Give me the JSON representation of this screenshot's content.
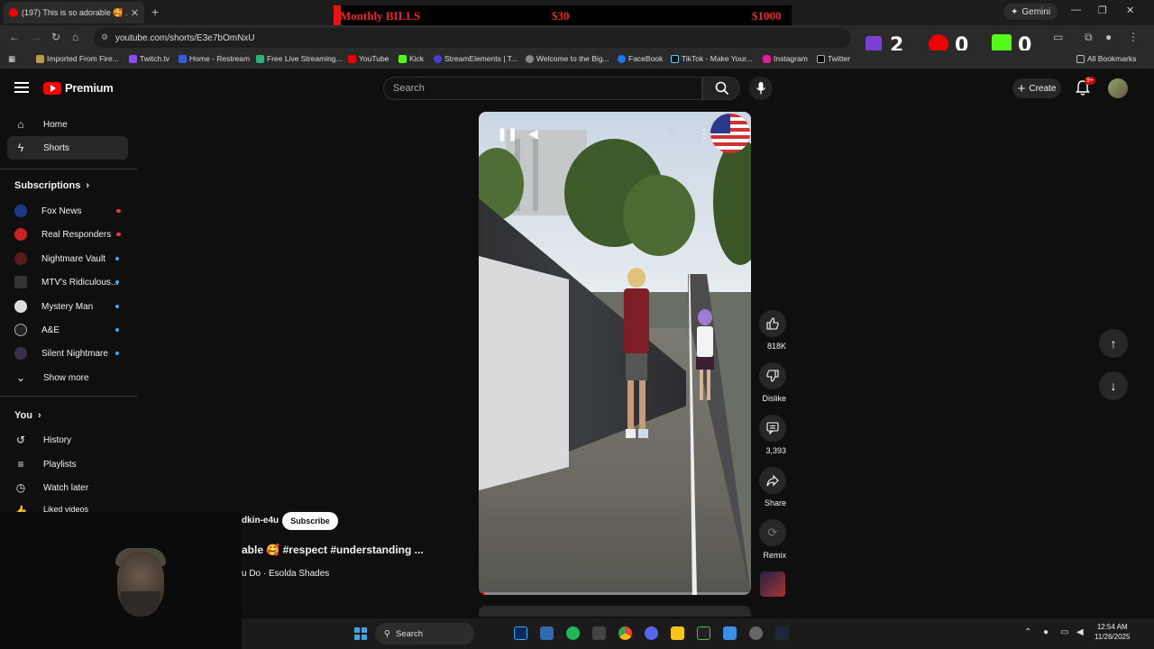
{
  "browser": {
    "tab_title": "(197) This is so adorable 🥰 ...",
    "url": "youtube.com/shorts/E3e7bOmNxU",
    "gemini_label": "Gemini",
    "bookmarks": [
      "Imported From Fire...",
      "Twitch.tv",
      "Home - Restream",
      "Free Live Streaming...",
      "YouTube",
      "Kick",
      "StreamElements | T...",
      "Welcome to the Big...",
      "FaceBook",
      "TikTok - Make Your...",
      "Instagram",
      "Twitter"
    ],
    "all_bookmarks_label": "All Bookmarks"
  },
  "overlay_bills": {
    "title": "Monthly BILLS",
    "value1": "$30",
    "value2": "$1000"
  },
  "stream_counters": {
    "twitch": "2",
    "youtube": "0",
    "kick": "0"
  },
  "yt": {
    "logo_text": "Premium",
    "search_placeholder": "Search",
    "create_label": "Create",
    "notif_badge": "9+"
  },
  "sidebar": {
    "primary": [
      {
        "label": "Home"
      },
      {
        "label": "Shorts"
      }
    ],
    "subscriptions_header": "Subscriptions",
    "subscriptions": [
      {
        "label": "Fox News"
      },
      {
        "label": "Real Responders"
      },
      {
        "label": "Nightmare Vault"
      },
      {
        "label": "MTV's Ridiculous..."
      },
      {
        "label": "Mystery Man"
      },
      {
        "label": "A&E"
      },
      {
        "label": "Silent Nightmare"
      }
    ],
    "show_more": "Show more",
    "you_header": "You",
    "you_items": [
      {
        "label": "History"
      },
      {
        "label": "Playlists"
      },
      {
        "label": "Watch later"
      },
      {
        "label": "Liked videos"
      }
    ]
  },
  "short": {
    "channel": "dkin-e4u",
    "subscribe_label": "Subscribe",
    "title": "able 🥰 #respect #understanding ...",
    "music": "u Do · Esolda Shades",
    "progress": 0.02
  },
  "actions": {
    "likes": "818K",
    "dislike": "Dislike",
    "comments": "3,393",
    "share": "Share",
    "remix": "Remix"
  },
  "taskbar": {
    "search_label": "Search",
    "time": "12:54 AM",
    "date": "11/26/2025"
  },
  "colors": {
    "background": "#0f0f0f",
    "accent_red": "#ff0000",
    "bills_red": "#ee2222"
  }
}
